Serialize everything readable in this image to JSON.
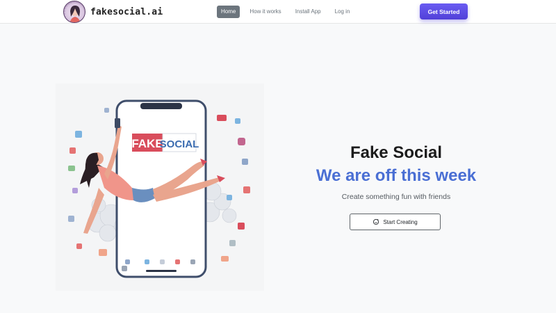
{
  "header": {
    "brand": "fakesocial.ai",
    "nav": [
      {
        "label": "Home",
        "active": true
      },
      {
        "label": "How it works",
        "active": false
      },
      {
        "label": "Install App",
        "active": false
      },
      {
        "label": "Log in",
        "active": false
      }
    ],
    "cta_label": "Get Started"
  },
  "hero": {
    "illustration_text": {
      "fake": "FAKE",
      "social": "SOCIAL"
    },
    "title": "Fake Social",
    "subtitle": "We are off this week",
    "description": "Create something fun with friends",
    "button_label": "Start Creating",
    "button_icon": "sparkle-icon"
  },
  "colors": {
    "accent_blue": "#4a6fd4",
    "cta_purple": "#5b4be6",
    "nav_active": "#6c757d"
  }
}
